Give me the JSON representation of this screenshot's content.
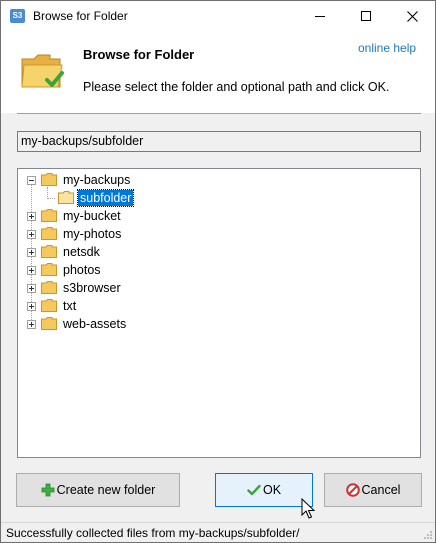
{
  "window": {
    "title": "Browse for Folder",
    "app_icon_text": "S3"
  },
  "header": {
    "title": "Browse for Folder",
    "description": "Please select the folder and optional path and click OK.",
    "help_link": "online help"
  },
  "path_field": {
    "value": "my-backups/subfolder"
  },
  "tree": {
    "items": [
      {
        "label": "my-backups",
        "expanded": true,
        "selected": false
      },
      {
        "label": "subfolder",
        "child": true,
        "selected": true
      },
      {
        "label": "my-bucket",
        "expanded": false,
        "selected": false
      },
      {
        "label": "my-photos",
        "expanded": false,
        "selected": false
      },
      {
        "label": "netsdk",
        "expanded": false,
        "selected": false
      },
      {
        "label": "photos",
        "expanded": false,
        "selected": false
      },
      {
        "label": "s3browser",
        "expanded": false,
        "selected": false
      },
      {
        "label": "txt",
        "expanded": false,
        "selected": false
      },
      {
        "label": "web-assets",
        "expanded": false,
        "selected": false
      }
    ]
  },
  "buttons": {
    "create_folder": "Create new folder",
    "ok": "OK",
    "cancel": "Cancel"
  },
  "status": {
    "text": "Successfully collected files from my-backups/subfolder/"
  },
  "colors": {
    "selection": "#0078d7",
    "link": "#1e7bb8",
    "folder": "#f5c95b"
  }
}
